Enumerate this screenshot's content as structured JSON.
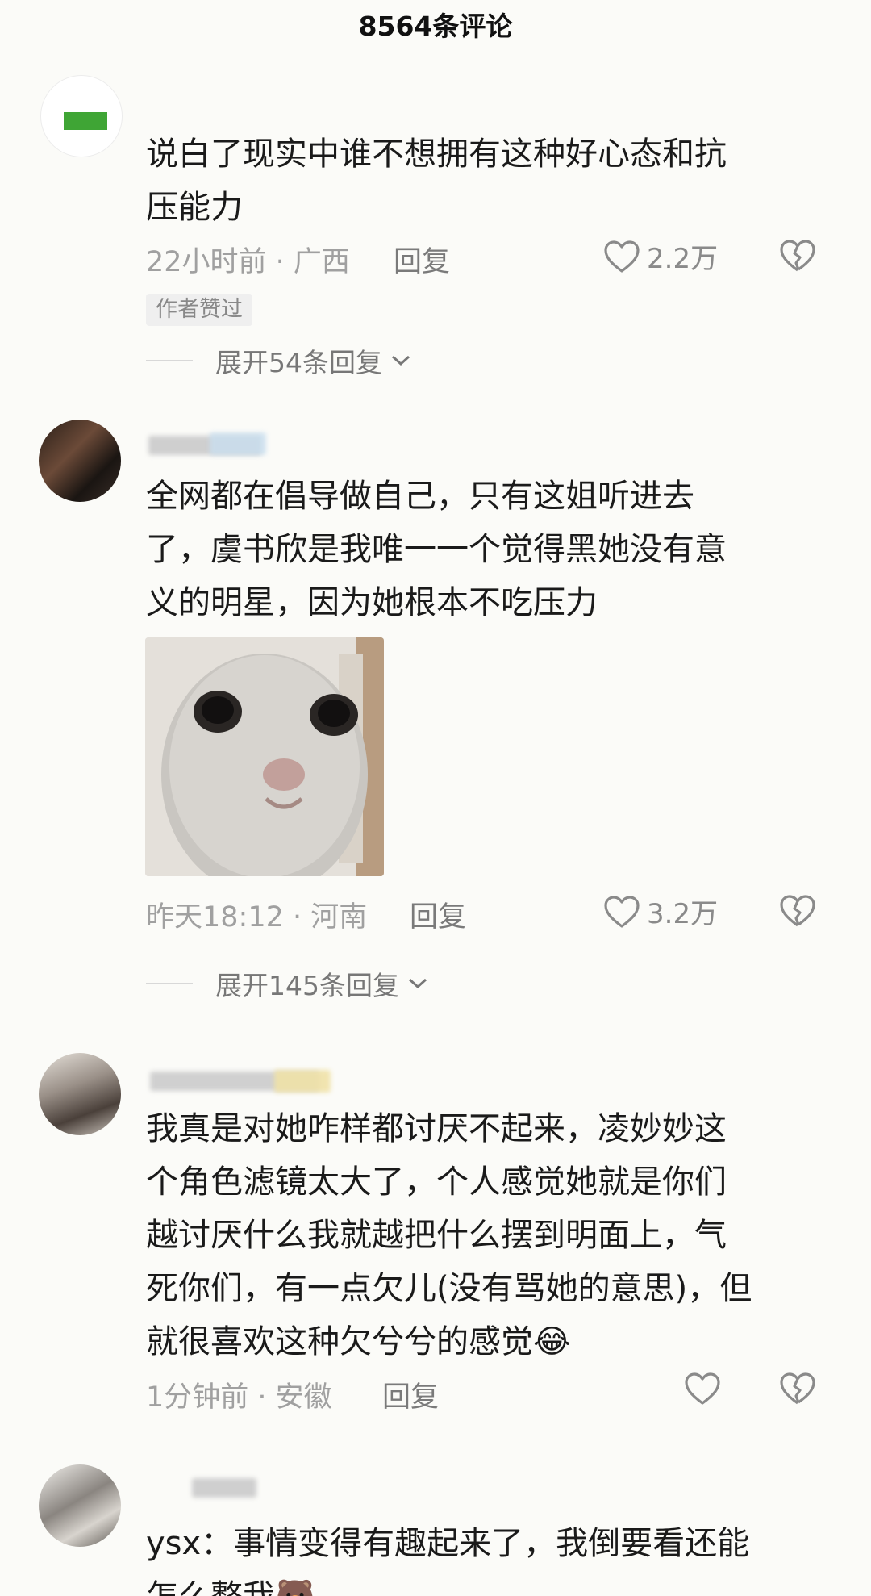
{
  "header": {
    "title": "8564条评论"
  },
  "comments": [
    {
      "text_lines": [
        "说白了现实中谁不想拥有这种好心态和抗",
        "压能力"
      ],
      "time_location": "22小时前 · 广西",
      "reply_label": "回复",
      "like_count": "2.2万",
      "tag": "作者赞过",
      "expand_label": "展开54条回复"
    },
    {
      "text_lines": [
        "全网都在倡导做自己，只有这姐听进去",
        "了，虞书欣是我唯一一个觉得黑她没有意",
        "义的明星，因为她根本不吃压力"
      ],
      "time_location": "昨天18:12 · 河南",
      "reply_label": "回复",
      "like_count": "3.2万",
      "expand_label": "展开145条回复"
    },
    {
      "text_lines": [
        "我真是对她咋样都讨厌不起来，凌妙妙这",
        "个角色滤镜太大了，个人感觉她就是你们",
        "越讨厌什么我就越把什么摆到明面上，气",
        "死你们，有一点欠儿(没有骂她的意思)，但",
        "就很喜欢这种欠兮兮的感觉"
      ],
      "emoji": "😂",
      "time_location": "1分钟前 · 安徽",
      "reply_label": "回复"
    },
    {
      "text_lines": [
        "ysx：事情变得有趣起来了，我倒要看还能",
        "怎么整我"
      ],
      "emoji": "🐻"
    }
  ],
  "colors": {
    "like_icon": "#8a8a8a",
    "tag_bg": "#efefef",
    "accent_green": "#3fa535"
  },
  "icons": [
    "heart-icon",
    "broken-heart-icon",
    "chevron-down-icon"
  ]
}
